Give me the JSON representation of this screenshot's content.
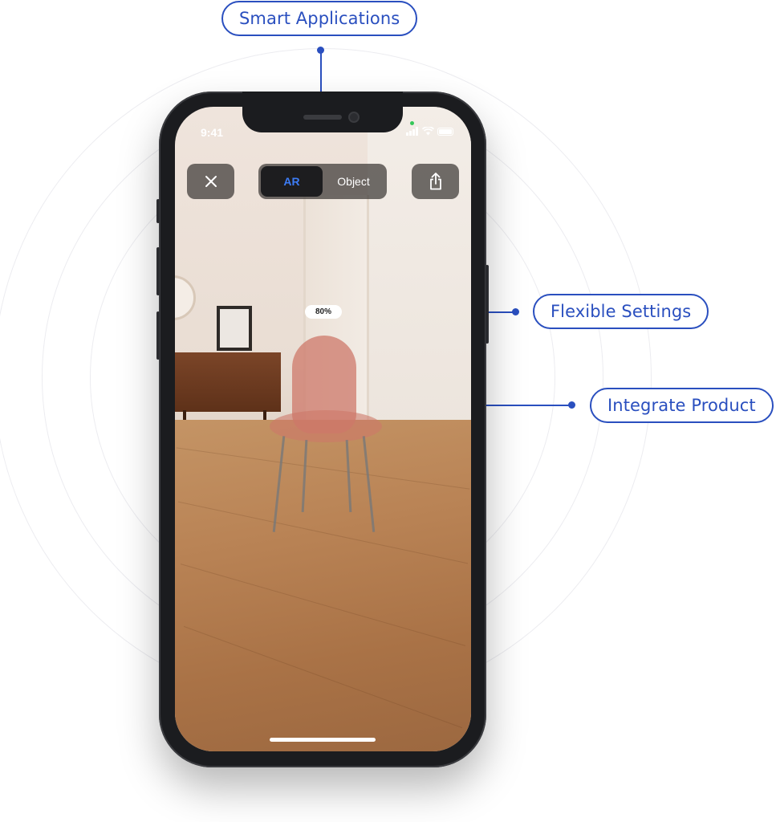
{
  "callouts": {
    "top": "Smart Applications",
    "right_upper": "Flexible Settings",
    "right_lower": "Integrate Product"
  },
  "status_bar": {
    "time": "9:41"
  },
  "ar_view": {
    "mode_options": [
      "AR",
      "Object"
    ],
    "active_mode": "AR",
    "scale_label": "80%"
  },
  "icons": {
    "close": "close-icon",
    "share": "share-icon"
  },
  "colors": {
    "accent": "#2a4fbf",
    "active_segment_text": "#3d7cf5"
  }
}
